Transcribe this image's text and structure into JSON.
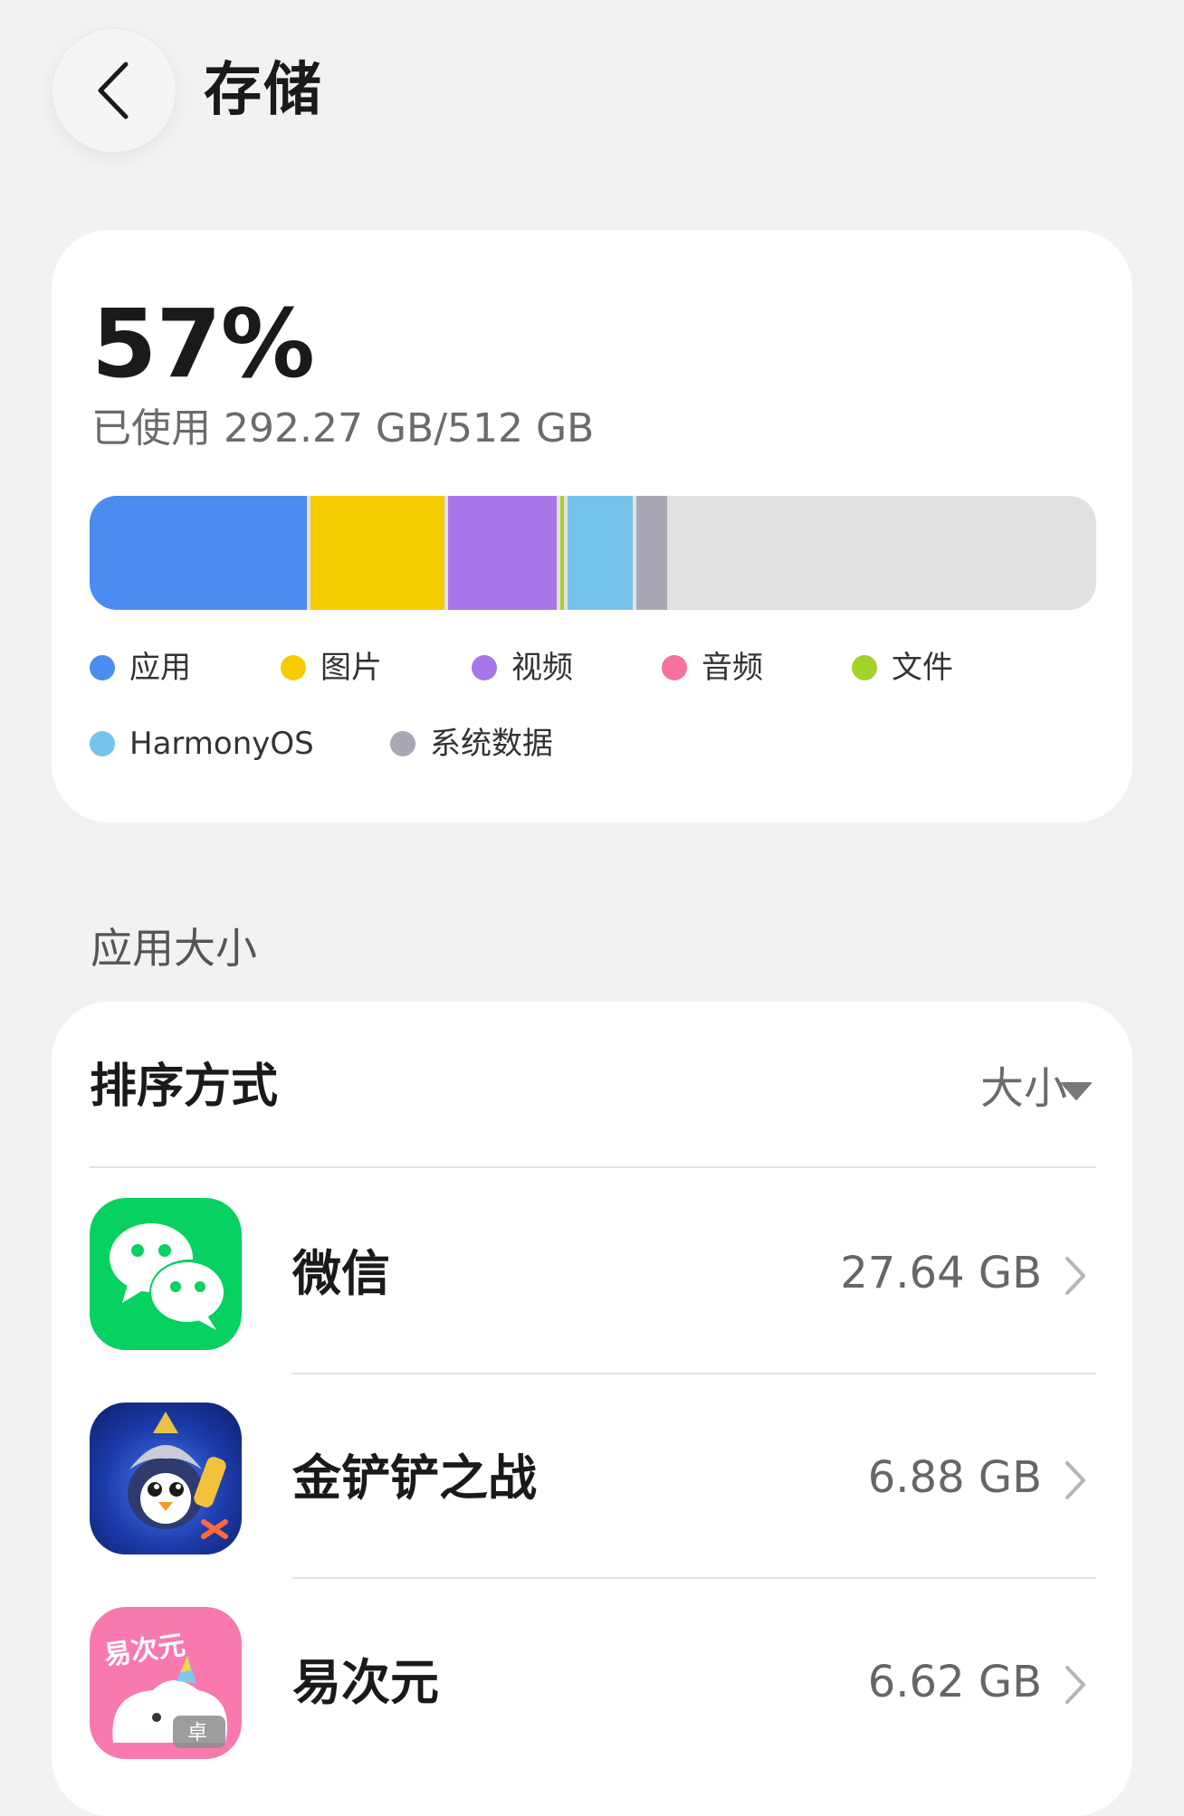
{
  "header": {
    "title": "存储",
    "back_icon": "chevron-left-icon"
  },
  "storage": {
    "percent": "57%",
    "used_text": "已使用 292.27 GB/512 GB",
    "used_fraction": 0.57,
    "segments": [
      {
        "name": "应用",
        "color": "#4a8cf0"
      },
      {
        "name": "图片",
        "color": "#f5cc00"
      },
      {
        "name": "视频",
        "color": "#a777ea"
      },
      {
        "name": "音频",
        "color": "#f5719f"
      },
      {
        "name": "文件",
        "color": "#a3d22a"
      },
      {
        "name": "HarmonyOS",
        "color": "#75c3ea"
      },
      {
        "name": "系统数据",
        "color": "#a8a8b4"
      }
    ],
    "free_color": "#e1e1e1"
  },
  "app_size_section": {
    "label": "应用大小",
    "sort_label": "排序方式",
    "sort_value": "大小",
    "apps": [
      {
        "name": "微信",
        "size": "27.64 GB",
        "icon": "wechat-icon"
      },
      {
        "name": "金铲铲之战",
        "size": "6.88 GB",
        "icon": "golden-spatula-game-icon"
      },
      {
        "name": "易次元",
        "size": "6.62 GB",
        "icon": "yiciyuan-icon",
        "icon_text": "易次元",
        "badge": "卓"
      }
    ]
  }
}
